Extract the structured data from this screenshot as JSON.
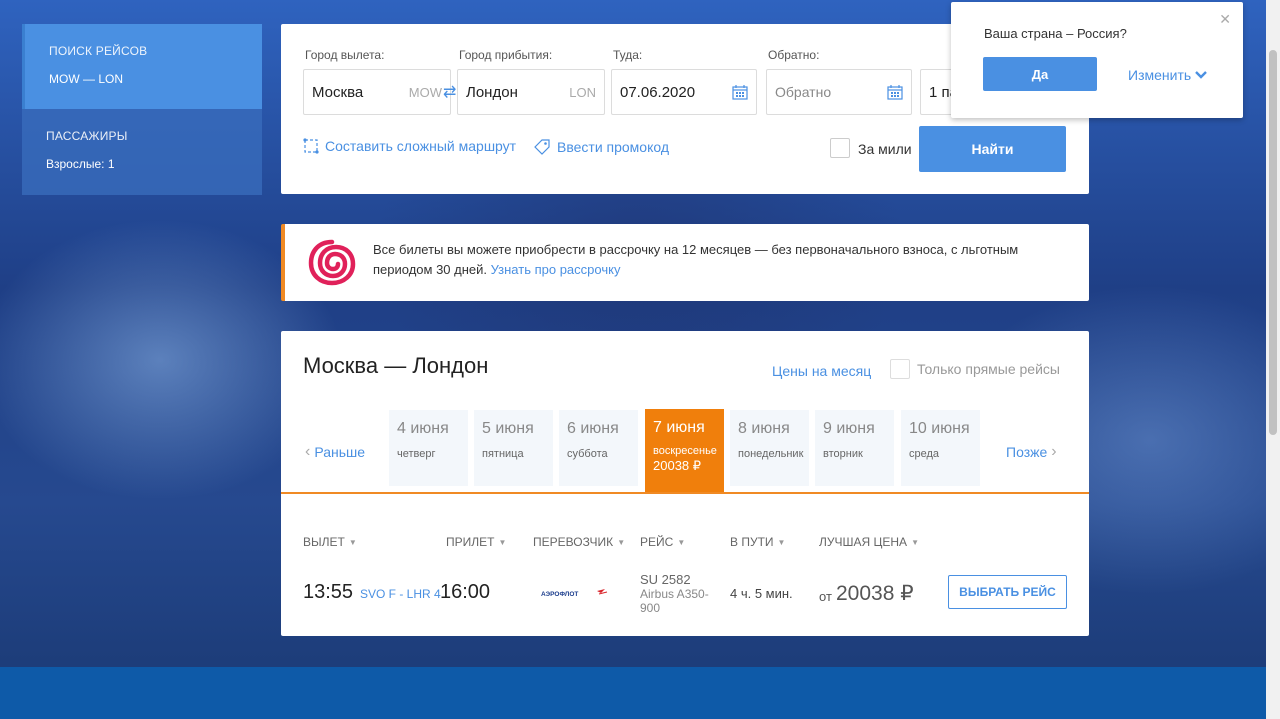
{
  "sidebar": {
    "search": {
      "title": "Поиск рейсов",
      "route": "MOW — LON"
    },
    "passengers": {
      "title": "Пассажиры",
      "count": "Взрослые: 1"
    }
  },
  "search": {
    "from_label": "Город вылета:",
    "from_value": "Москва",
    "from_code": "MOW",
    "to_label": "Город прибытия:",
    "to_value": "Лондон",
    "to_code": "LON",
    "depart_label": "Туда:",
    "depart_value": "07.06.2020",
    "return_label": "Обратно:",
    "return_placeholder": "Обратно",
    "passengers_value": "1 па",
    "complex_route": "Составить сложный маршрут",
    "promo": "Ввести промокод",
    "miles_label": "За мили",
    "find_button": "Найти"
  },
  "banner": {
    "text": "Все билеты вы можете приобрести в рассрочку на 12 месяцев — без первоначального взноса, с льготным периодом 30 дней.",
    "link": "Узнать про рассрочку"
  },
  "results": {
    "title": "Москва — Лондон",
    "month_prices": "Цены на месяц",
    "direct_only": "Только прямые рейсы",
    "prev": "Раньше",
    "next": "Позже",
    "dates": [
      {
        "date": "4 июня",
        "weekday": "четверг"
      },
      {
        "date": "5 июня",
        "weekday": "пятница"
      },
      {
        "date": "6 июня",
        "weekday": "суббота"
      },
      {
        "date": "7 июня",
        "weekday": "воскресенье",
        "price": "20038 ₽"
      },
      {
        "date": "8 июня",
        "weekday": "понедельник"
      },
      {
        "date": "9 июня",
        "weekday": "вторник"
      },
      {
        "date": "10 июня",
        "weekday": "среда"
      }
    ],
    "columns": {
      "departure": "Вылет",
      "arrival": "Прилет",
      "carrier": "Перевозчик",
      "flight": "Рейс",
      "duration": "В пути",
      "best_price": "Лучшая цена"
    },
    "flight": {
      "dep_time": "13:55",
      "route": "SVO F - LHR 4",
      "arr_time": "16:00",
      "carrier_logo_text": "АЭРОФЛОТ",
      "flight_no": "SU 2582",
      "aircraft": "Airbus A350-900",
      "duration": "4 ч. 5 мин.",
      "price_prefix": "от",
      "price": "20038 ₽",
      "select_button": "Выбрать рейс"
    }
  },
  "popup": {
    "question": "Ваша страна – Россия?",
    "yes": "Да",
    "change": "Изменить"
  },
  "colors": {
    "accent": "#4a90e2",
    "orange": "#f07f0c"
  }
}
